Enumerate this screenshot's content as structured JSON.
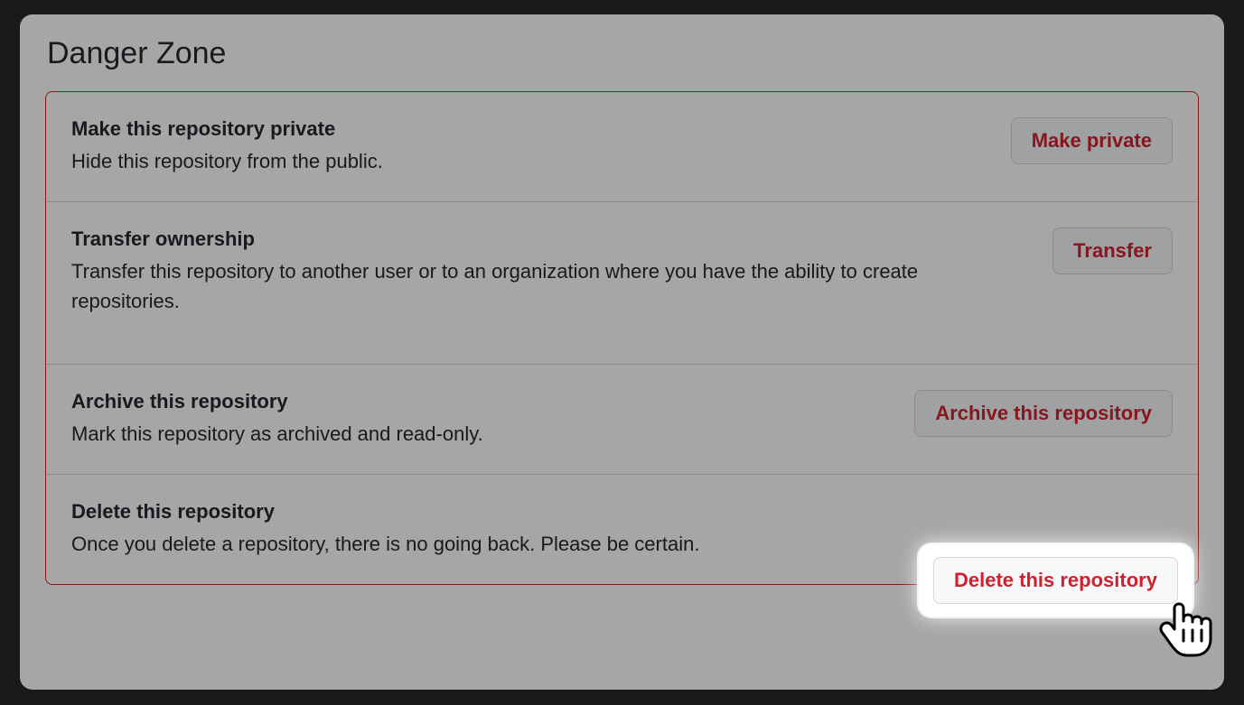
{
  "title": "Danger Zone",
  "rows": {
    "make_private": {
      "title": "Make this repository private",
      "desc": "Hide this repository from the public.",
      "button": "Make private"
    },
    "transfer": {
      "title": "Transfer ownership",
      "desc": "Transfer this repository to another user or to an organization where you have the ability to create repositories.",
      "button": "Transfer"
    },
    "archive": {
      "title": "Archive this repository",
      "desc": "Mark this repository as archived and read-only.",
      "button": "Archive this repository"
    },
    "delete": {
      "title": "Delete this repository",
      "desc": "Once you delete a repository, there is no going back. Please be certain.",
      "button": "Delete this repository"
    }
  }
}
